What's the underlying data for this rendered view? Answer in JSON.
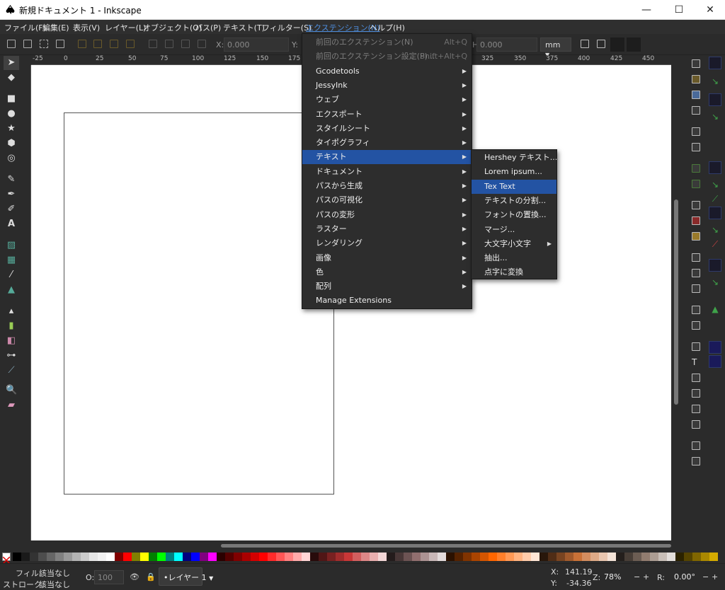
{
  "window": {
    "title": "新規ドキュメント 1 - Inkscape",
    "minimize": "—",
    "maximize": "☐",
    "close": "✕"
  },
  "menubar": [
    "ファイル(F)",
    "編集(E)",
    "表示(V)",
    "レイヤー(L)",
    "オブジェクト(O)",
    "パス(P)",
    "テキスト(T)",
    "フィルター(S)",
    "エクステンション(N)",
    "ヘルプ(H)"
  ],
  "toolbar": {
    "x_label": "X:",
    "x_value": "0.000",
    "y_label": "Y:",
    "h_label": "H:",
    "h_value": "0.000",
    "unit": "mm"
  },
  "ruler_ticks": [
    "-25",
    "0",
    "25",
    "50",
    "75",
    "100",
    "125",
    "150",
    "175",
    "325",
    "350",
    "375",
    "400",
    "425",
    "450"
  ],
  "extensions_menu": {
    "items": [
      {
        "label": "前回のエクステンション(N)",
        "shortcut": "Alt+Q",
        "disabled": true,
        "submenu": false
      },
      {
        "label": "前回のエクステンション設定(P)...",
        "shortcut": "Shift+Alt+Q",
        "disabled": true,
        "submenu": false
      },
      {
        "label": "Gcodetools",
        "submenu": true
      },
      {
        "label": "JessyInk",
        "submenu": true
      },
      {
        "label": "ウェブ",
        "submenu": true
      },
      {
        "label": "エクスポート",
        "submenu": true
      },
      {
        "label": "スタイルシート",
        "submenu": true
      },
      {
        "label": "タイポグラフィ",
        "submenu": true
      },
      {
        "label": "テキスト",
        "submenu": true,
        "highlighted": true
      },
      {
        "label": "ドキュメント",
        "submenu": true
      },
      {
        "label": "パスから生成",
        "submenu": true
      },
      {
        "label": "パスの可視化",
        "submenu": true
      },
      {
        "label": "パスの変形",
        "submenu": true
      },
      {
        "label": "ラスター",
        "submenu": true
      },
      {
        "label": "レンダリング",
        "submenu": true
      },
      {
        "label": "画像",
        "submenu": true
      },
      {
        "label": "色",
        "submenu": true
      },
      {
        "label": "配列",
        "submenu": true
      },
      {
        "label": "Manage Extensions",
        "submenu": false
      }
    ]
  },
  "text_submenu": {
    "items": [
      {
        "label": "Hershey テキスト...",
        "submenu": false
      },
      {
        "label": "Lorem ipsum...",
        "submenu": false
      },
      {
        "label": "Tex Text",
        "submenu": false,
        "highlighted": true
      },
      {
        "label": "テキストの分割...",
        "submenu": false
      },
      {
        "label": "フォントの置換...",
        "submenu": false
      },
      {
        "label": "マージ...",
        "submenu": false
      },
      {
        "label": "大文字小文字",
        "submenu": true
      },
      {
        "label": "抽出...",
        "submenu": false
      },
      {
        "label": "点字に変換",
        "submenu": false
      }
    ]
  },
  "palette_colors": [
    "#000000",
    "#1a1a1a",
    "#333333",
    "#4d4d4d",
    "#666666",
    "#808080",
    "#999999",
    "#b3b3b3",
    "#cccccc",
    "#e6e6e6",
    "#f2f2f2",
    "#ffffff",
    "#800000",
    "#ff0000",
    "#808000",
    "#ffff00",
    "#008000",
    "#00ff00",
    "#008080",
    "#00ffff",
    "#000080",
    "#0000ff",
    "#800080",
    "#ff00ff",
    "#2b0000",
    "#550000",
    "#800000",
    "#aa0000",
    "#d40000",
    "#ff0000",
    "#ff2a2a",
    "#ff5555",
    "#ff8080",
    "#ffaaaa",
    "#ffd5d5",
    "#280b0b",
    "#501616",
    "#782121",
    "#a02c2c",
    "#c83737",
    "#d35f5f",
    "#de8787",
    "#e9afaf",
    "#f4d7d7",
    "#241c1c",
    "#483737",
    "#6c5353",
    "#916f6f",
    "#ac9393",
    "#c8b7b7",
    "#e3dbdb",
    "#2b1100",
    "#552200",
    "#803300",
    "#aa4400",
    "#d45500",
    "#ff6600",
    "#ff7f2a",
    "#ff9955",
    "#ffb380",
    "#ffccaa",
    "#ffe6d5",
    "#28170b",
    "#502d16",
    "#784421",
    "#a05a2c",
    "#c87137",
    "#d38d5f",
    "#deaa87",
    "#e9c6af",
    "#f4e3d7",
    "#241f1c",
    "#483e37",
    "#6c5d53",
    "#917c6f",
    "#ac9d93",
    "#c8beb7",
    "#e3dedb",
    "#2b2200",
    "#554400",
    "#806600",
    "#aa8800",
    "#d4aa00"
  ],
  "status": {
    "fill_label": "フィル:",
    "fill_value": "該当なし",
    "stroke_label": "ストローク:",
    "stroke_value": "該当なし",
    "opacity_label": "O:",
    "opacity_value": "100",
    "layer": "•レイヤー 1",
    "x_label": "X:",
    "x_value": "141.19",
    "y_label": "Y:",
    "y_value": "-34.36",
    "zoom_label": "Z:",
    "zoom_value": "78%",
    "rotation_label": "R:",
    "rotation_value": "0.00°",
    "minus": "−",
    "plus": "+"
  }
}
